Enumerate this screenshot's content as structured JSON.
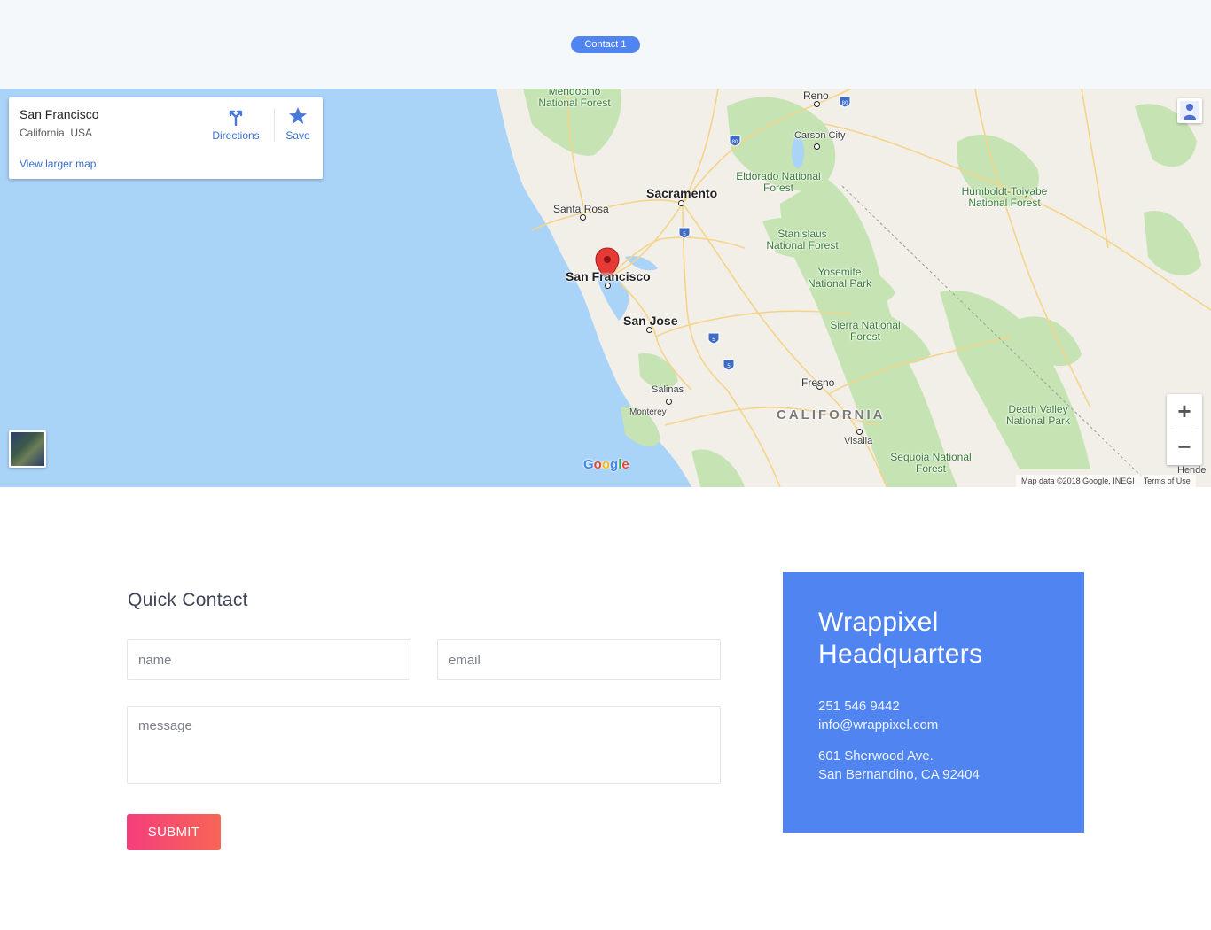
{
  "header": {
    "badge": "Contact 1"
  },
  "map": {
    "place_card": {
      "place": "San Francisco",
      "region": "California, USA",
      "directions_label": "Directions",
      "save_label": "Save",
      "larger_map_link": "View larger map"
    },
    "labels": {
      "mendocino": "Mendocino National Forest",
      "reno": "Reno",
      "carson": "Carson City",
      "eldorado": "Eldorado National Forest",
      "sacramento": "Sacramento",
      "santa_rosa": "Santa Rosa",
      "stanislaus": "Stanislaus National Forest",
      "humboldt": "Humboldt-Toiyabe National Forest",
      "san_francisco": "San Francisco",
      "yosemite": "Yosemite National Park",
      "san_jose": "San Jose",
      "sierra": "Sierra National Forest",
      "salinas": "Salinas",
      "monterey": "Monterey",
      "fresno": "Fresno",
      "california": "CALIFORNIA",
      "visalia": "Visalia",
      "death_valley": "Death Valley National Park",
      "sequoia": "Sequoia National Forest",
      "hende": "Hende"
    },
    "shields": [
      "80",
      "80",
      "5",
      "5",
      "5"
    ],
    "zoom_in": "+",
    "zoom_out": "−",
    "google_logo": "Google",
    "attribution": "Map data ©2018 Google, INEGI",
    "terms": "Terms of Use"
  },
  "contact_form": {
    "title": "Quick Contact",
    "name_placeholder": "name",
    "email_placeholder": "email",
    "message_placeholder": "message",
    "submit_label": "SUBMIT"
  },
  "headquarters": {
    "title_line1": "Wrappixel",
    "title_line2": "Headquarters",
    "phone": "251 546 9442",
    "email": "info@wrappixel.com",
    "address_line1": "601 Sherwood Ave.",
    "address_line2": "San Bernandino, CA 92404"
  },
  "colors": {
    "accent": "#5084f0",
    "submit_gradient_start": "#f43e7d",
    "submit_gradient_end": "#f76555",
    "ocean": "#aad3f8",
    "land": "#f2efe9",
    "forest": "#c5e3b3"
  }
}
